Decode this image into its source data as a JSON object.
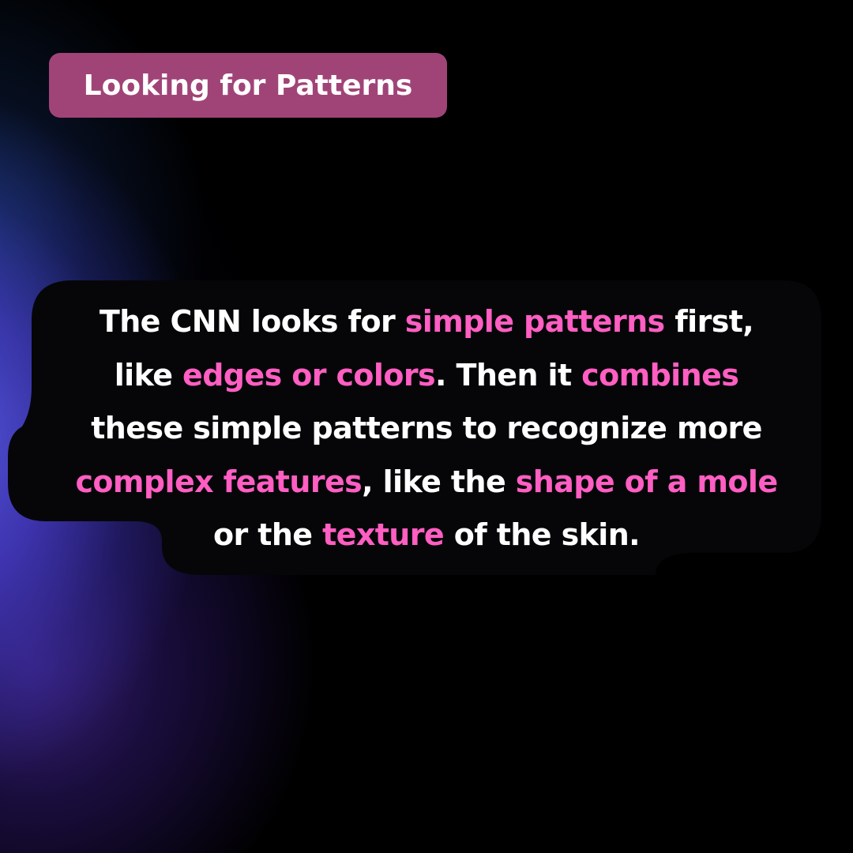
{
  "title": "Looking for Patterns",
  "colors": {
    "pill": "#a04478",
    "highlight": "#ff5ec2",
    "text": "#ffffff",
    "panel": "#060609"
  },
  "body": {
    "line1": {
      "a": "The CNN looks for ",
      "b": "simple patterns",
      "c": " first,"
    },
    "line2": {
      "a": "like ",
      "b": "edges or colors",
      "c": ". Then it ",
      "d": "combines"
    },
    "line3": {
      "a": "these simple patterns to recognize more"
    },
    "line4": {
      "a": "complex features",
      "b": ", like the ",
      "c": "shape of a mole"
    },
    "line5": {
      "a": "or the ",
      "b": "texture",
      "c": " of the skin."
    }
  }
}
